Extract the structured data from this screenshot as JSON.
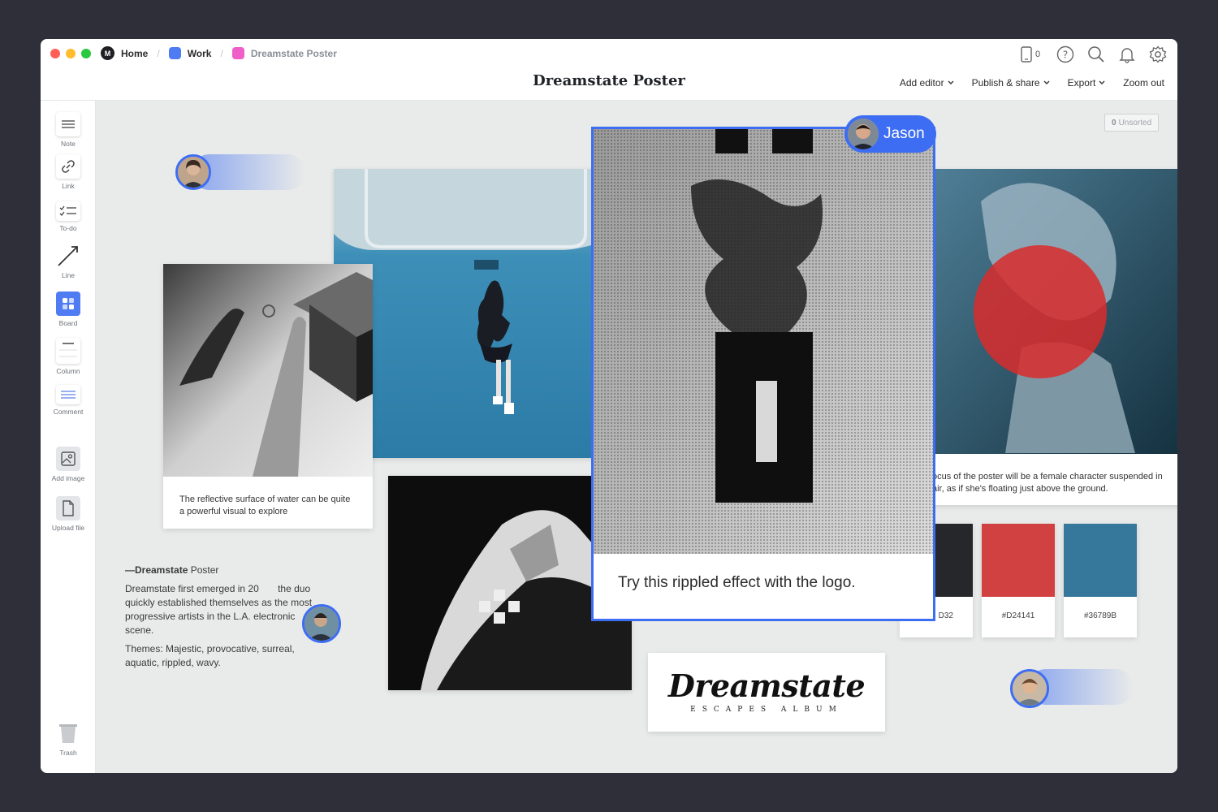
{
  "breadcrumbs": [
    {
      "label": "Home",
      "color": "#1f1f24"
    },
    {
      "label": "Work",
      "color": "#4f7cf3"
    },
    {
      "label": "Dreamstate Poster",
      "color": "#f05fc8"
    }
  ],
  "window": {
    "title": "Dreamstate Poster"
  },
  "toolbar": {
    "device_count": "0",
    "menu": [
      "Add editor",
      "Publish & share",
      "Export",
      "Zoom out"
    ]
  },
  "sidebar": {
    "tools": [
      {
        "label": "Note",
        "icon": "note-icon"
      },
      {
        "label": "Link",
        "icon": "link-icon"
      },
      {
        "label": "To-do",
        "icon": "todo-icon"
      },
      {
        "label": "Line",
        "icon": "line-icon"
      },
      {
        "label": "Board",
        "icon": "board-icon",
        "active": true
      },
      {
        "label": "Column",
        "icon": "column-icon"
      },
      {
        "label": "Comment",
        "icon": "comment-icon"
      },
      {
        "label": "Add image",
        "icon": "image-icon"
      },
      {
        "label": "Upload file",
        "icon": "file-icon"
      }
    ],
    "trash": "Trash"
  },
  "canvas": {
    "unsorted_count": "0",
    "unsorted_label": "Unsorted",
    "hands_caption": "The reflective surface of water can be quite a powerful visual to explore",
    "focus_caption": "ocus of the poster will be a female character suspended in air, as if  she's floating just above the ground.",
    "note": {
      "title_bold": "—Dreamstate",
      "title_rest": " Poster",
      "para1": "Dreamstate first emerged in 20       the duo quickly established themselves as the most progressive artists in the L.A. electronic scene.",
      "para2": "Themes: Majestic, provocative, surreal, aquatic, rippled, wavy."
    },
    "jason": {
      "name": "Jason",
      "caption": "Try this rippled effect with the logo."
    },
    "swatches": [
      {
        "hex": "D32",
        "color": "#26272b"
      },
      {
        "hex": "#D24141",
        "color": "#d24141"
      },
      {
        "hex": "#36789B",
        "color": "#36789b"
      }
    ],
    "logo": {
      "title": "Dreamstate",
      "subtitle": "ESCAPES ALBUM"
    }
  },
  "colors": {
    "accent": "#3d6df2",
    "background": "#2f2f3a",
    "canvas": "#e9ebea"
  }
}
